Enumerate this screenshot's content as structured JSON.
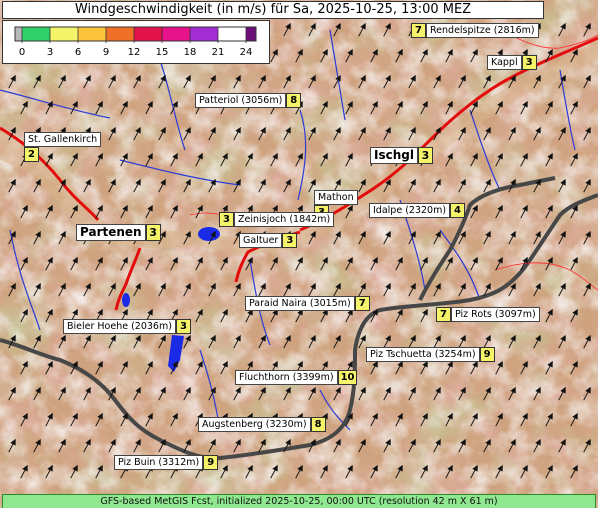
{
  "title": "Windgeschwindigkeit (in m/s) für Sa, 2025-10-25, 13:00 MEZ",
  "footer": "GFS-based MetGIS Fcst, initialized 2025-10-25, 00:00 UTC  (resolution 42 m X 61 m)",
  "legend": {
    "ticks": [
      "0",
      "3",
      "6",
      "9",
      "12",
      "15",
      "18",
      "21",
      "24"
    ],
    "colors": [
      "#b8b8b8",
      "#2fd06a",
      "#f4f36a",
      "#fbc43c",
      "#f07028",
      "#e4124a",
      "#e6138a",
      "#a32cd4",
      "#6a1078"
    ]
  },
  "wind_direction": "south-southwest (arrows point north-northeast)",
  "points": [
    {
      "name": "Rendelspitze (2816m)",
      "value": "7",
      "value_first": true
    },
    {
      "name": "Kappl",
      "value": "3",
      "value_first": false
    },
    {
      "name": "Patteriol (3056m)",
      "value": "8",
      "value_first": false
    },
    {
      "name": "St. Gallenkirch",
      "value": "2",
      "value_first": false,
      "value_below": true
    },
    {
      "name": "Ischgl",
      "value": "3",
      "value_first": false
    },
    {
      "name": "Mathon",
      "value": "3",
      "value_first": false,
      "value_below": true
    },
    {
      "name": "Idalpe (2320m)",
      "value": "4",
      "value_first": false
    },
    {
      "name": "Zeinisjoch (1842m)",
      "value": "3",
      "value_first": true
    },
    {
      "name": "Partenen",
      "value": "3",
      "value_first": false
    },
    {
      "name": "Galtuer",
      "value": "3",
      "value_first": false
    },
    {
      "name": "Paraid Naira (3015m)",
      "value": "7",
      "value_first": false
    },
    {
      "name": "Piz Rots (3097m)",
      "value": "7",
      "value_first": true
    },
    {
      "name": "Bieler Hoehe (2036m)",
      "value": "3",
      "value_first": false
    },
    {
      "name": "Piz Tschuetta (3254m)",
      "value": "9",
      "value_first": false
    },
    {
      "name": "Fluchthorn (3399m)",
      "value": "10",
      "value_first": false
    },
    {
      "name": "Augstenberg (3230m)",
      "value": "8",
      "value_first": false
    },
    {
      "name": "Piz Buin (3312m)",
      "value": "9",
      "value_first": false
    }
  ]
}
